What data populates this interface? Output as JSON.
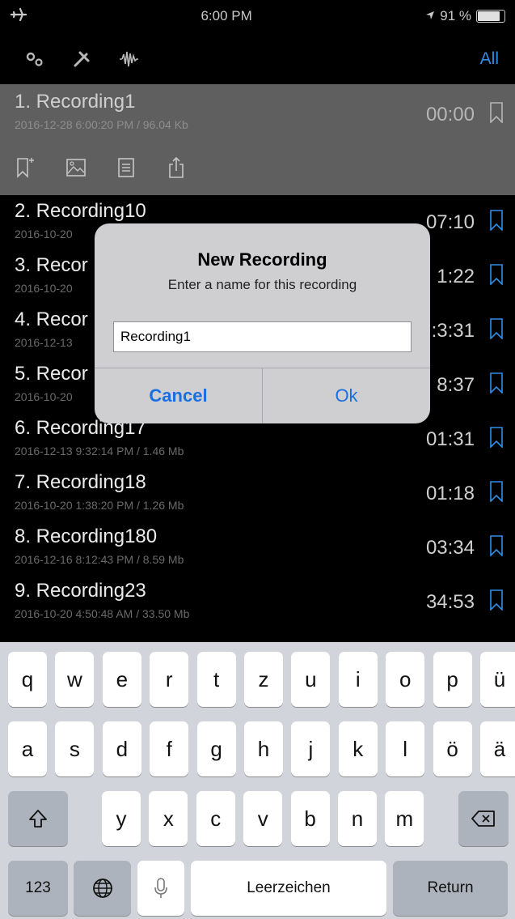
{
  "status": {
    "time": "6:00 PM",
    "battery": "91 %",
    "battery_level": 0.91
  },
  "toolbar": {
    "all_label": "All",
    "icons": [
      "settings-icon",
      "tools-icon",
      "waveform-icon"
    ]
  },
  "recordings": [
    {
      "title": "1. Recording1",
      "meta": "2016-12-28 6:00:20 PM / 96.04 Kb",
      "duration": "00:00"
    },
    {
      "title": "2. Recording10",
      "meta": "2016-10-20",
      "duration": "07:10"
    },
    {
      "title": "3. Recor",
      "meta": "2016-10-20",
      "duration": "1:22"
    },
    {
      "title": "4. Recor",
      "meta": "2016-12-13",
      "duration": ":3:31"
    },
    {
      "title": "5. Recor",
      "meta": "2016-10-20",
      "duration": "8:37"
    },
    {
      "title": "6. Recording17",
      "meta": "2016-12-13 9:32:14 PM / 1.46 Mb",
      "duration": "01:31"
    },
    {
      "title": "7. Recording18",
      "meta": "2016-10-20 1:38:20 PM / 1.26 Mb",
      "duration": "01:18"
    },
    {
      "title": "8. Recording180",
      "meta": "2016-12-16 8:12:43 PM / 8.59 Mb",
      "duration": "03:34"
    },
    {
      "title": "9. Recording23",
      "meta": "2016-10-20 4:50:48 AM / 33.50 Mb",
      "duration": "34:53"
    }
  ],
  "selected_actions": [
    "add-bookmark-icon",
    "image-icon",
    "notes-icon",
    "share-icon"
  ],
  "alert": {
    "title": "New Recording",
    "message": "Enter a name for this recording",
    "input_value": "Recording1",
    "cancel_label": "Cancel",
    "ok_label": "Ok"
  },
  "keyboard": {
    "row1": [
      "q",
      "w",
      "e",
      "r",
      "t",
      "z",
      "u",
      "i",
      "o",
      "p",
      "ü"
    ],
    "row2": [
      "a",
      "s",
      "d",
      "f",
      "g",
      "h",
      "j",
      "k",
      "l",
      "ö",
      "ä"
    ],
    "row3": [
      "y",
      "x",
      "c",
      "v",
      "b",
      "n",
      "m"
    ],
    "numbers_label": "123",
    "space_label": "Leerzeichen",
    "return_label": "Return"
  },
  "colors": {
    "accent": "#2f8ee8",
    "selected_row": "#5f5f5f",
    "keyboard_bg": "#d1d4da",
    "function_key": "#adb3bc"
  }
}
